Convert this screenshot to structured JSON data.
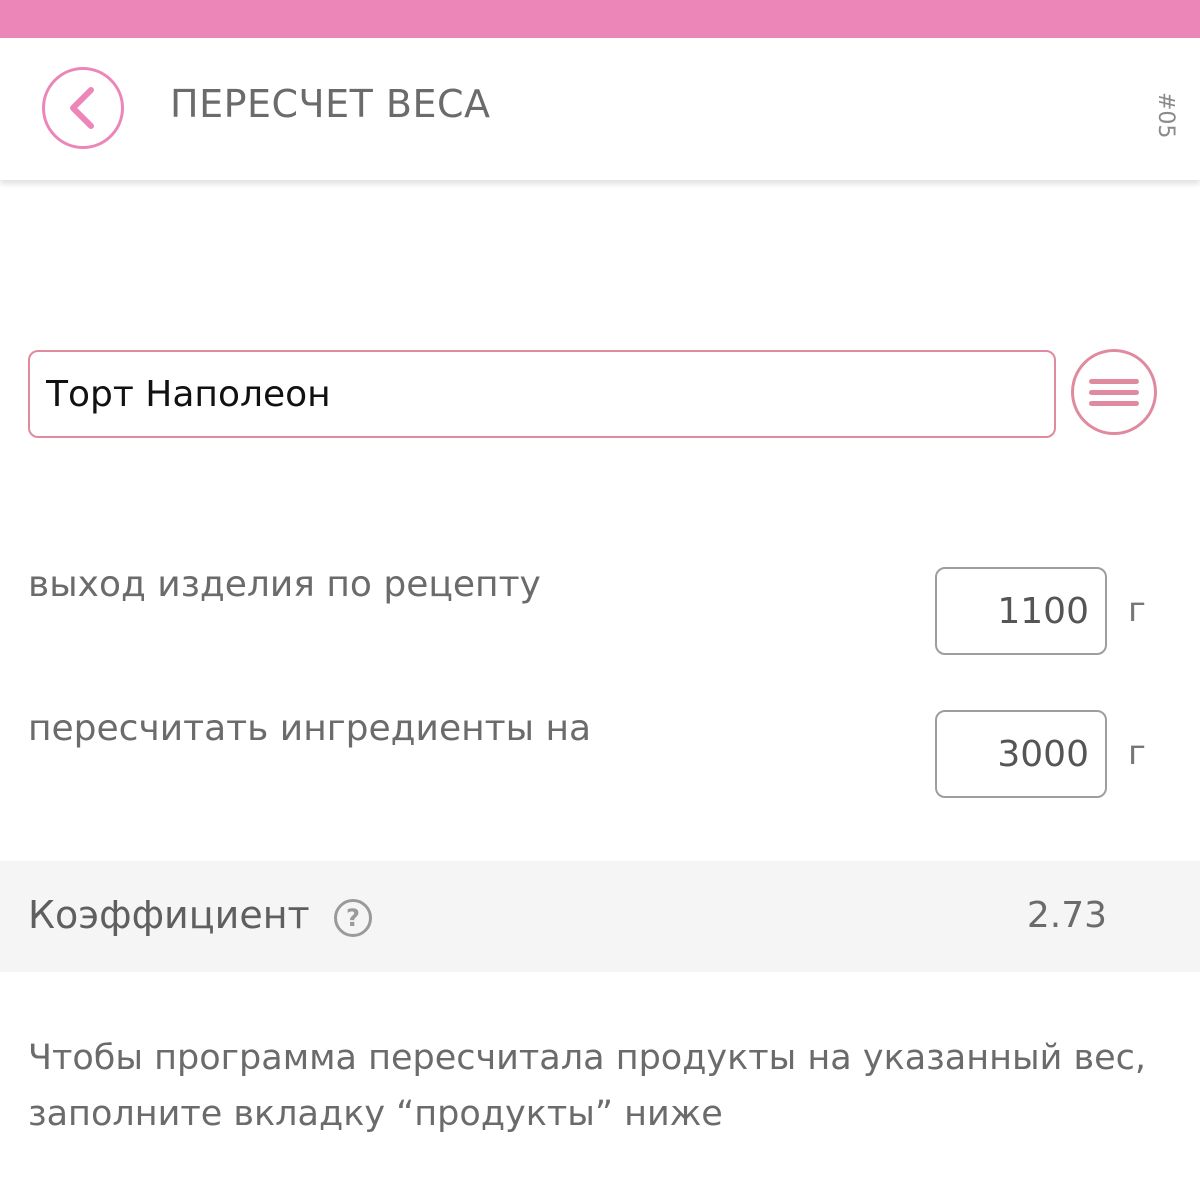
{
  "header": {
    "title": "ПЕРЕСЧЕТ ВЕСА",
    "code": "#05",
    "back_icon": "chevron-left-icon",
    "accent_color": "#ec86b9"
  },
  "recipe": {
    "name": "Торт Наполеон",
    "menu_icon": "menu-icon",
    "accent_color": "#e08aa0"
  },
  "yield_row": {
    "label": "выход изделия по рецепту",
    "value": "1100",
    "unit": "г"
  },
  "target_row": {
    "label": "пересчитать ингредиенты на",
    "value": "3000",
    "unit": "г"
  },
  "coefficient": {
    "label": "Коэффициент",
    "help_icon": "help-icon",
    "help_symbol": "?",
    "value": "2.73"
  },
  "hint": {
    "text": "Чтобы программа пересчитала продукты на указанный вес, заполните вкладку “продукты” ниже"
  }
}
